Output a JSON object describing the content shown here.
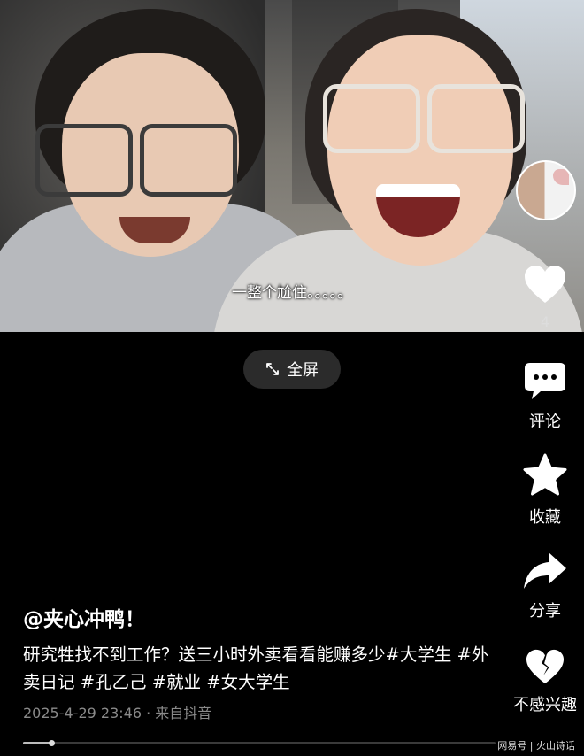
{
  "video": {
    "subtitle": "一整个尬住。。。。。"
  },
  "fullscreen": {
    "label": "全屏",
    "icon": "expand-arrows-icon"
  },
  "rail": {
    "like_count": "4",
    "comment_label": "评论",
    "collect_label": "收藏",
    "share_label": "分享",
    "not_interested_label": "不感兴趣"
  },
  "post": {
    "author": "@夹心冲鸭！",
    "description": "研究牲找不到工作？送三小时外卖看看能赚多少#大学生 #外卖日记 #孔乙己 #就业 #女大学生",
    "meta": "2025-4-29 23:46 · 来自抖音",
    "progress": 0.06
  },
  "watermark": "网易号 | 火山诗话"
}
